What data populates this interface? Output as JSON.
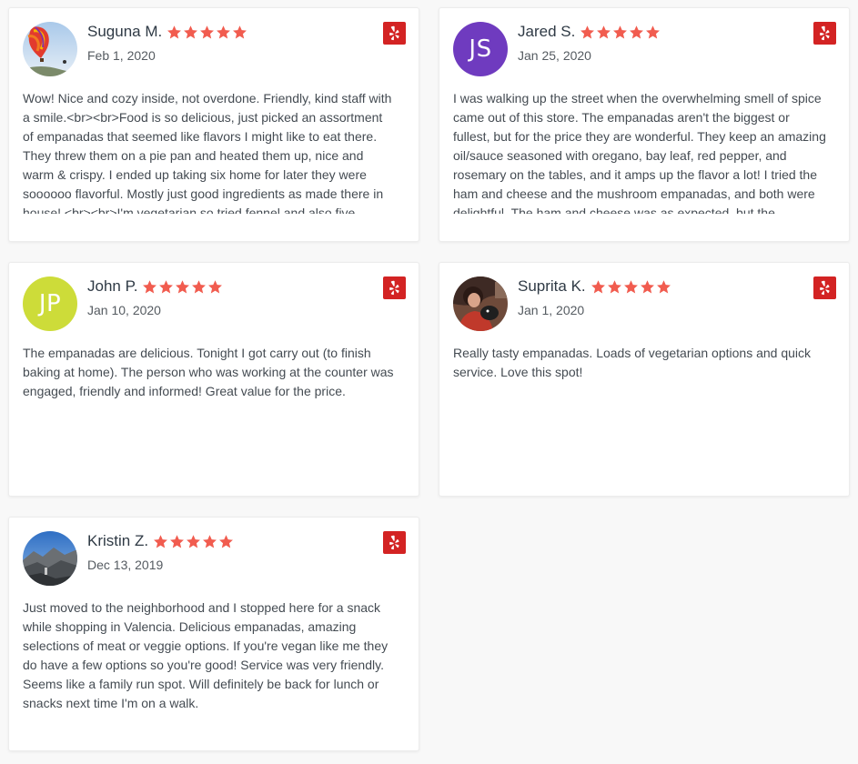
{
  "colors": {
    "star": "#f15c4f",
    "yelp_brand": "#d32323",
    "name_text": "#2f3a45",
    "body_text": "#444b52"
  },
  "icons": {
    "rating_star": "star-icon",
    "source": "yelp-logo-icon"
  },
  "reviews": [
    {
      "name": "Suguna M.",
      "date": "Feb 1, 2020",
      "rating": 5,
      "avatar": {
        "type": "photo",
        "subject": "hot-air-balloon"
      },
      "text": "Wow! Nice and cozy inside, not overdone. Friendly, kind staff with a smile.<br><br>Food is so delicious, just picked an assortment of empanadas that seemed like flavors I might like to eat there. They threw them on a pie pan and heated them up, nice and warm & crispy.  I ended up taking six home for later they were soooooo flavorful. Mostly just good ingredients as made there in house!  <br><br>I'm vegetarian so tried fennel and also five"
    },
    {
      "name": "Jared S.",
      "date": "Jan 25, 2020",
      "rating": 5,
      "avatar": {
        "type": "initials",
        "initials": "JS",
        "color": "#6f3bbf"
      },
      "text": "I was walking up the street when the overwhelming smell of spice came out of this store.  The empanadas aren't the biggest or fullest, but for the  price they are wonderful. They keep an amazing oil/sauce seasoned with oregano, bay leaf, red pepper, and rosemary on the tables, and it amps up the flavor a lot! I tried the ham and cheese  and the mushroom empanadas, and both were delightful.  The ham and cheese was as expected, but the"
    },
    {
      "name": "John P.",
      "date": "Jan 10, 2020",
      "rating": 5,
      "avatar": {
        "type": "initials",
        "initials": "JP",
        "color": "#cddc39"
      },
      "text": "The empanadas are delicious.  Tonight I got carry out (to finish baking at home).  The person who was working at the counter was engaged, friendly and informed!  Great value for the price."
    },
    {
      "name": "Suprita K.",
      "date": "Jan 1, 2020",
      "rating": 5,
      "avatar": {
        "type": "photo",
        "subject": "person-with-dog"
      },
      "text": "Really tasty empanadas. Loads of vegetarian options and quick service. Love this spot!"
    },
    {
      "name": "Kristin Z.",
      "date": "Dec 13, 2019",
      "rating": 5,
      "avatar": {
        "type": "photo",
        "subject": "mountain-landscape"
      },
      "text": "Just moved to the neighborhood and I stopped here for a snack while shopping in Valencia. Delicious empanadas, amazing selections of meat or veggie options. If you're vegan like me they do have a few options so you're good! Service was very friendly. Seems like a family run spot. Will definitely be back for lunch or snacks next time I'm on a walk."
    }
  ]
}
